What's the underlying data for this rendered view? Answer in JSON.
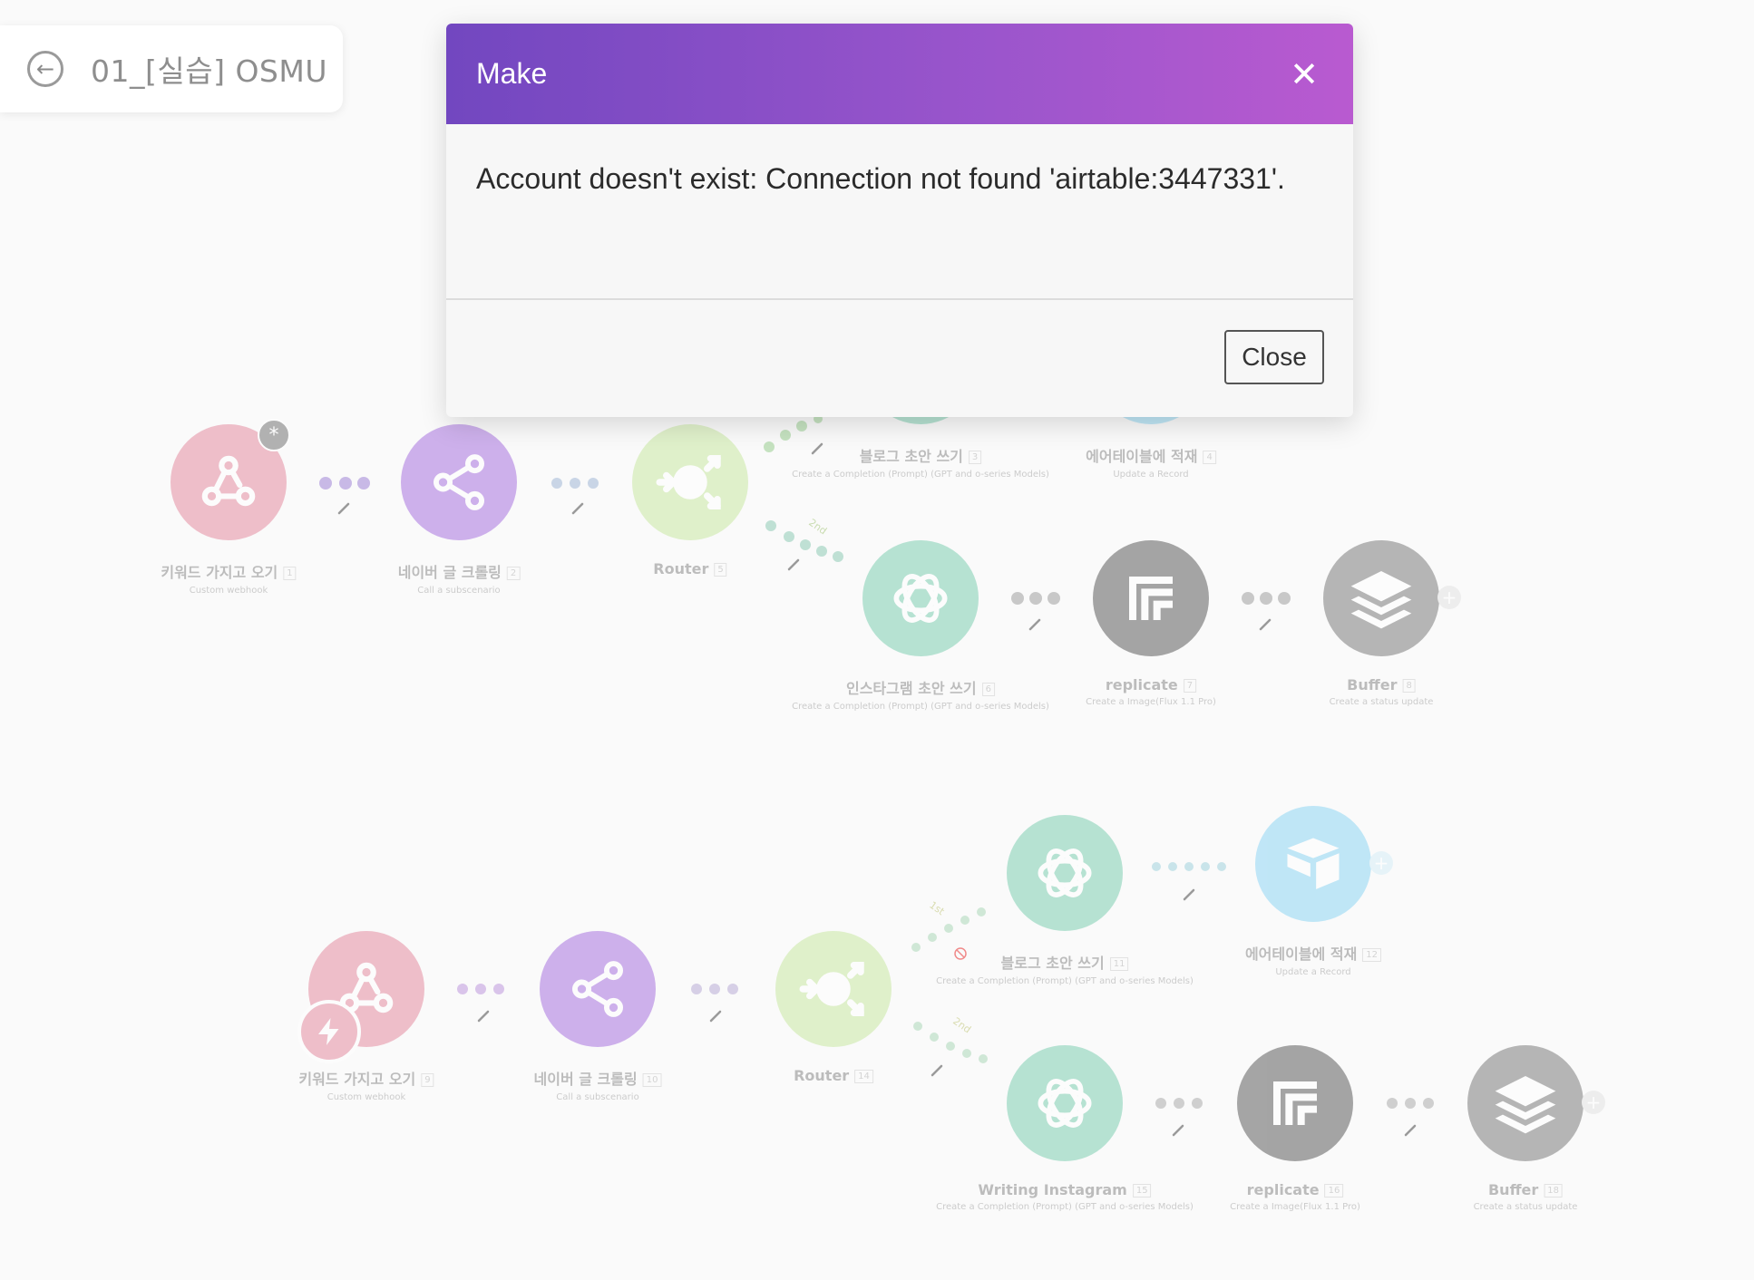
{
  "scenario": {
    "title": "01_[실습] OSMU"
  },
  "modal": {
    "title": "Make",
    "message": "Account doesn't exist: Connection not found 'airtable:3447331'.",
    "close_label": "Close"
  },
  "route_labels": {
    "first": "1st",
    "second": "2nd"
  },
  "modules": [
    {
      "name": "키워드 가지고 오기",
      "num": "1",
      "sub": "Custom webhook"
    },
    {
      "name": "네이버 글 크롤링",
      "num": "2",
      "sub": "Call a subscenario"
    },
    {
      "name": "Router",
      "num": "5",
      "sub": ""
    },
    {
      "name": "블로그 초안 쓰기",
      "num": "3",
      "sub": "Create a Completion (Prompt) (GPT and o-series Models)"
    },
    {
      "name": "에어테이블에 적재",
      "num": "4",
      "sub": "Update a Record"
    },
    {
      "name": "인스타그램 초안 쓰기",
      "num": "6",
      "sub": "Create a Completion (Prompt) (GPT and o-series Models)"
    },
    {
      "name": "replicate",
      "num": "7",
      "sub": "Create a Image(Flux 1.1 Pro)"
    },
    {
      "name": "Buffer",
      "num": "8",
      "sub": "Create a status update"
    },
    {
      "name": "키워드 가지고 오기",
      "num": "9",
      "sub": "Custom webhook"
    },
    {
      "name": "네이버 글 크롤링",
      "num": "10",
      "sub": "Call a subscenario"
    },
    {
      "name": "Router",
      "num": "14",
      "sub": ""
    },
    {
      "name": "블로그 초안 쓰기",
      "num": "11",
      "sub": "Create a Completion (Prompt) (GPT and o-series Models)"
    },
    {
      "name": "에어테이블에 적재",
      "num": "12",
      "sub": "Update a Record"
    },
    {
      "name": "Writing Instagram",
      "num": "15",
      "sub": "Create a Completion (Prompt) (GPT and o-series Models)"
    },
    {
      "name": "replicate",
      "num": "16",
      "sub": "Create a Image(Flux 1.1 Pro)"
    },
    {
      "name": "Buffer",
      "num": "18",
      "sub": "Create a status update"
    }
  ],
  "icons": {
    "webhook": "webhook-icon",
    "subscenario": "share-icon",
    "router": "router-icon",
    "openai": "openai-icon",
    "airtable": "airtable-icon",
    "replicate": "replicate-icon",
    "buffer": "buffer-icon"
  },
  "colors": {
    "webhook": "#e58ea2",
    "subscenario": "#a975e0",
    "router": "#c9e8a4",
    "openai": "#7fcfb3",
    "airtable": "#8fd6f4",
    "replicate": "#5e5e5e",
    "buffer": "#7d7d7d",
    "modal_gradient_start": "#7247c0",
    "modal_gradient_end": "#b95ad0"
  }
}
